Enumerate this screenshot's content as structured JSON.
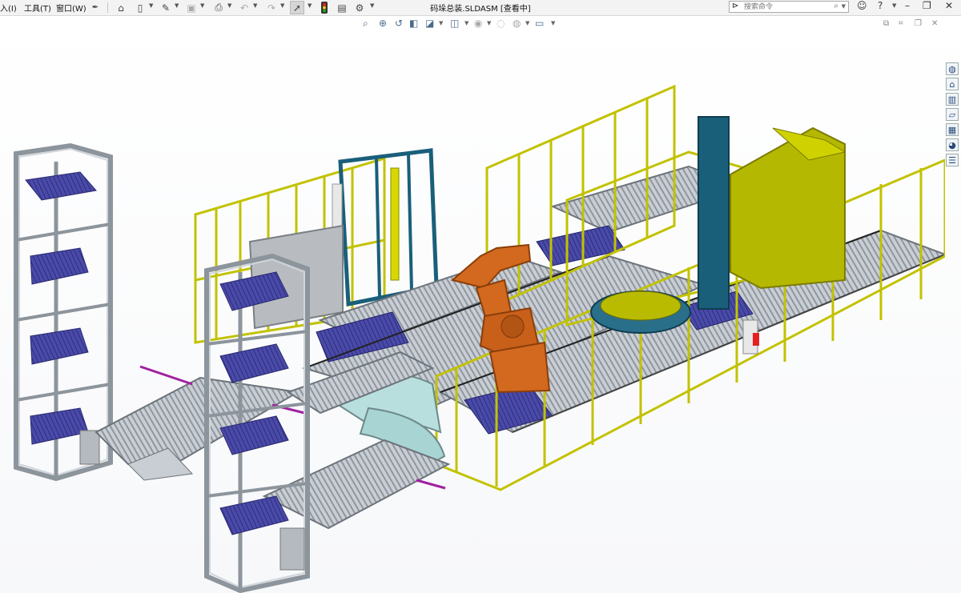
{
  "menu": {
    "insert": "入(I)",
    "tools": "工具(T)",
    "window": "窗口(W)"
  },
  "toolbar": {
    "icons": [
      "pin-icon",
      "home-icon",
      "new-document-icon",
      "open-icon",
      "save-icon",
      "print-icon",
      "undo-icon",
      "redo-icon",
      "select-icon",
      "traffic-light-icon",
      "options-icon",
      "gear-icon"
    ]
  },
  "document": {
    "title": "码垛总装.SLDASM [查看中]"
  },
  "search": {
    "placeholder": "搜索命令"
  },
  "colors": {
    "frame_yellow": "#c8c800",
    "robot_orange": "#d2691e",
    "teal": "#1a5f7a",
    "pallet_blue": "#3a3a9a",
    "olive": "#b5b800",
    "steel": "#9aa3ad"
  }
}
